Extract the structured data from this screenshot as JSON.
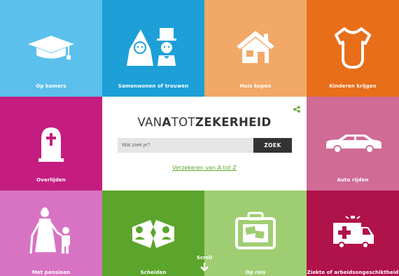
{
  "tiles": [
    {
      "label": "Op kamers",
      "color": "#5bc0eb",
      "icon": "graduation-cap-icon"
    },
    {
      "label": "Samenwonen of trouwen",
      "color": "#1d9fd8",
      "icon": "wedding-couple-icon"
    },
    {
      "label": "Huis kopen",
      "color": "#f2a867",
      "icon": "house-icon"
    },
    {
      "label": "Kinderen krijgen",
      "color": "#e86e1a",
      "icon": "baby-onesie-icon"
    },
    {
      "label": "Overlijden",
      "color": "#c41d7f",
      "icon": "tombstone-icon"
    },
    {
      "label": "Auto rijden",
      "color": "#cf6b95",
      "icon": "car-icon"
    },
    {
      "label": "Met pensioen",
      "color": "#d873c3",
      "icon": "elderly-with-child-icon"
    },
    {
      "label": "Scheiden",
      "color": "#5ca52c",
      "icon": "broken-couple-icon"
    },
    {
      "label": "Op reis",
      "color": "#9fce72",
      "icon": "suitcase-icon"
    },
    {
      "label": "Ziekte of arbeidsongeschiktheid",
      "color": "#b0124a",
      "icon": "ambulance-icon"
    }
  ],
  "center": {
    "logo_part1": "VAN",
    "logo_part2": "A",
    "logo_part3": "TOT",
    "logo_part4": "ZEKERHEID",
    "search_placeholder": "Wat zoek je?",
    "search_button": "ZOEK",
    "link": "Verzekeren van A tot Z",
    "share_icon": "share-icon"
  },
  "scroll": {
    "label": "Scroll"
  }
}
